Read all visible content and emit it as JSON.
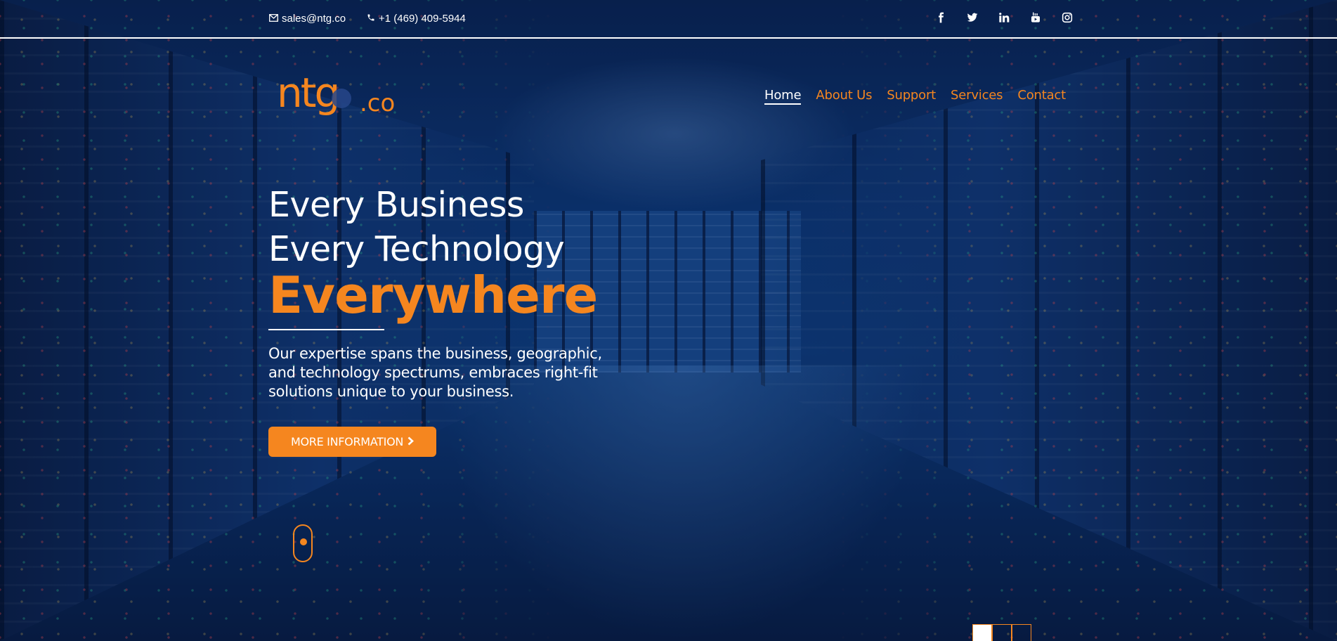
{
  "topbar": {
    "email": "sales@ntg.co",
    "phone": "+1 (469) 409-5944",
    "socials": [
      "facebook-icon",
      "twitter-icon",
      "linkedin-icon",
      "youtube-icon",
      "instagram-icon"
    ]
  },
  "logo": {
    "main": "ntg",
    "suffix": ".co"
  },
  "nav": {
    "items": [
      {
        "label": "Home",
        "active": true
      },
      {
        "label": "About Us",
        "active": false
      },
      {
        "label": "Support",
        "active": false
      },
      {
        "label": "Services",
        "active": false
      },
      {
        "label": "Contact",
        "active": false
      }
    ]
  },
  "hero": {
    "line1": "Every Business",
    "line2": "Every Technology",
    "line3": "Everywhere",
    "description": "Our expertise spans the business, geographic, and technology spectrums, embraces right-fit solutions unique to your business.",
    "cta_label": "MORE INFORMATION",
    "cta_icon": "chevron-right-icon"
  },
  "slider": {
    "count": 3,
    "active_index": 0
  },
  "colors": {
    "accent": "#f5861f",
    "text": "#ffffff",
    "background": "#0d3a7a"
  }
}
